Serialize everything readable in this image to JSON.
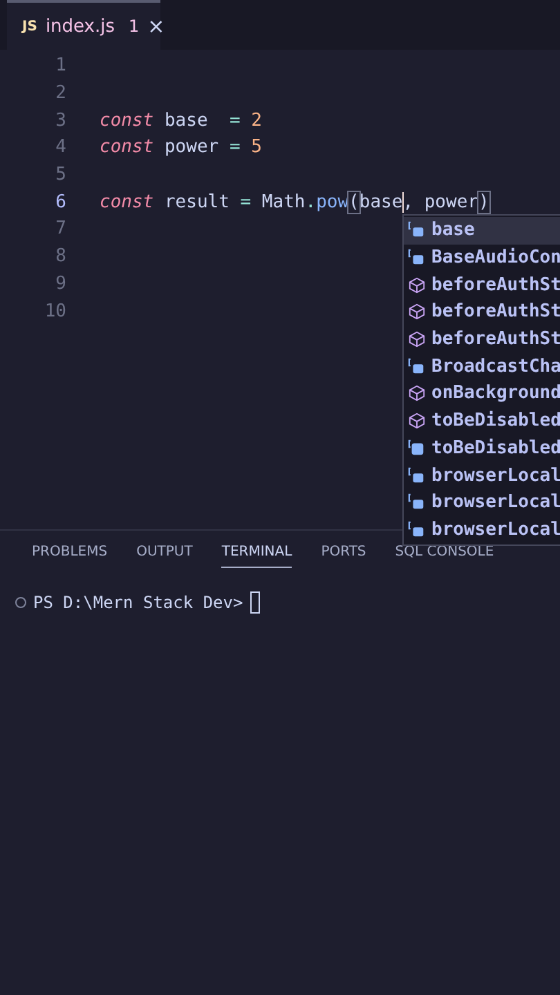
{
  "tab": {
    "icon_text": "JS",
    "filename": "index.js",
    "problems": "1",
    "close": "×",
    "selected": true
  },
  "editor": {
    "lines": [
      {
        "number": "1",
        "current": false
      },
      {
        "number": "2",
        "current": false
      },
      {
        "number": "3",
        "current": false,
        "tokens": [
          {
            "kind": "keyword",
            "text": "const"
          },
          {
            "kind": "ident",
            "text": " base  "
          },
          {
            "kind": "op",
            "text": "= "
          },
          {
            "kind": "number",
            "text": "2"
          }
        ]
      },
      {
        "number": "4",
        "current": false,
        "tokens": [
          {
            "kind": "keyword",
            "text": "const"
          },
          {
            "kind": "ident",
            "text": " power "
          },
          {
            "kind": "op",
            "text": "= "
          },
          {
            "kind": "number",
            "text": "5"
          }
        ]
      },
      {
        "number": "5",
        "current": false
      },
      {
        "number": "6",
        "current": true,
        "tokens": [
          {
            "kind": "keyword",
            "text": "const"
          },
          {
            "kind": "ident",
            "text": " result "
          },
          {
            "kind": "op",
            "text": "= "
          },
          {
            "kind": "ident",
            "text": "Math"
          },
          {
            "kind": "op",
            "text": "."
          },
          {
            "kind": "func",
            "text": "pow"
          },
          {
            "kind": "bracket",
            "text": "("
          },
          {
            "kind": "ident",
            "text": "base",
            "caret": true
          },
          {
            "kind": "ident",
            "text": ", power"
          },
          {
            "kind": "bracket",
            "text": ")"
          }
        ]
      },
      {
        "number": "7",
        "current": false
      },
      {
        "number": "8",
        "current": false
      },
      {
        "number": "9",
        "current": false
      },
      {
        "number": "10",
        "current": false
      }
    ]
  },
  "suggestions": [
    {
      "kind": "variable",
      "label": "base",
      "selected": true
    },
    {
      "kind": "variable",
      "label": "BaseAudioCon",
      "selected": false
    },
    {
      "kind": "module",
      "label": "beforeAuthSt",
      "selected": false
    },
    {
      "kind": "module",
      "label": "beforeAuthSt",
      "selected": false
    },
    {
      "kind": "module",
      "label": "beforeAuthSt",
      "selected": false
    },
    {
      "kind": "variable",
      "label": "BroadcastCha",
      "selected": false
    },
    {
      "kind": "module",
      "label": "onBackground",
      "selected": false
    },
    {
      "kind": "module",
      "label": "toBeDisabled",
      "selected": false
    },
    {
      "kind": "class",
      "label": "toBeDisabled",
      "selected": false
    },
    {
      "kind": "variable",
      "label": "browserLocal",
      "selected": false
    },
    {
      "kind": "variable",
      "label": "browserLocal",
      "selected": false
    },
    {
      "kind": "variable",
      "label": "browserLocal",
      "selected": false
    }
  ],
  "panel_tabs": [
    {
      "label": "PROBLEMS",
      "selected": false
    },
    {
      "label": "OUTPUT",
      "selected": false
    },
    {
      "label": "TERMINAL",
      "selected": true
    },
    {
      "label": "PORTS",
      "selected": false
    },
    {
      "label": "SQL CONSOLE",
      "selected": false
    }
  ],
  "terminal": {
    "prompt": "PS D:\\Mern Stack Dev>",
    "cursor": true
  }
}
